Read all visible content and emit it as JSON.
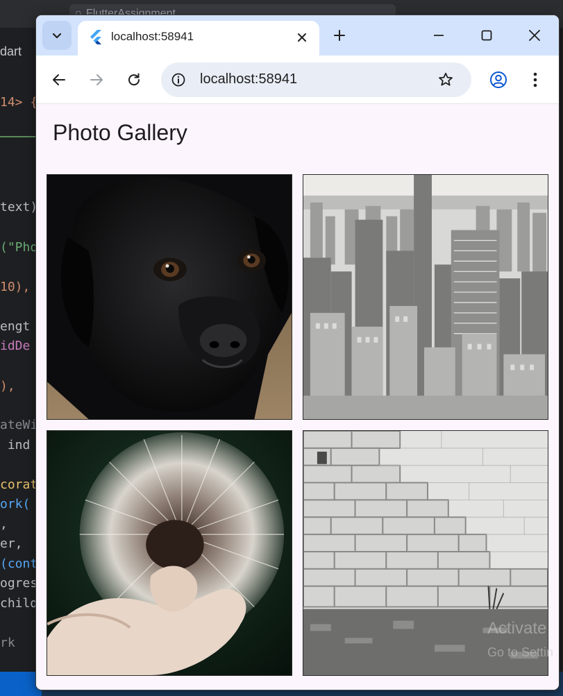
{
  "editor": {
    "search_text": "FlutterAssignment",
    "file_tab": "dart",
    "code_lines": [
      {
        "text": "14> {"
      },
      {
        "text": "text)"
      },
      {
        "text": "(\"Pho"
      },
      {
        "text": "10),"
      },
      {
        "text": "engt"
      },
      {
        "text": "idDe"
      },
      {
        "text": "),"
      },
      {
        "text": "ateWi"
      },
      {
        "text": " ind"
      },
      {
        "text": "corat"
      },
      {
        "text": "ork("
      },
      {
        "text": ","
      },
      {
        "text": "er,"
      },
      {
        "text": "(cont"
      },
      {
        "text": "ogres"
      },
      {
        "text": "child"
      },
      {
        "text": "rk"
      }
    ],
    "watermark": "Activate",
    "watermark_sub": "Go to Settin"
  },
  "browser": {
    "tab": {
      "title": "localhost:58941",
      "favicon": "flutter-icon"
    },
    "address": "localhost:58941",
    "icons": {
      "tab_search": "chevron-down-icon",
      "close_tab": "close-icon",
      "new_tab": "plus-icon",
      "minimize": "minimize-icon",
      "maximize": "maximize-icon",
      "close_window": "close-icon",
      "back": "back-arrow-icon",
      "forward": "forward-arrow-icon",
      "reload": "reload-icon",
      "site_info": "info-icon",
      "bookmark": "star-icon",
      "profile": "profile-icon",
      "menu": "kebab-menu-icon"
    },
    "colors": {
      "tabstrip": "#d3e3fd",
      "page_background": "#fcf5fd",
      "accent": "#0b57d0"
    }
  },
  "page": {
    "title": "Photo Gallery",
    "photos": [
      {
        "subject": "black puppy"
      },
      {
        "subject": "city skyline"
      },
      {
        "subject": "dandelion"
      },
      {
        "subject": "brick wall"
      }
    ]
  }
}
